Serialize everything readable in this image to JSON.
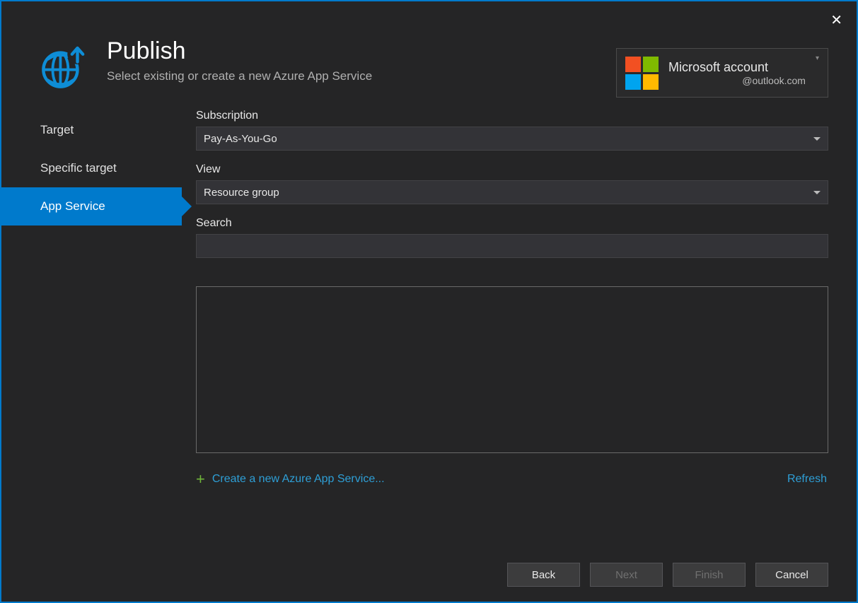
{
  "header": {
    "title": "Publish",
    "subtitle": "Select existing or create a new Azure App Service"
  },
  "account": {
    "label": "Microsoft account",
    "email": "@outlook.com"
  },
  "sidebar": {
    "items": [
      {
        "label": "Target",
        "selected": false
      },
      {
        "label": "Specific target",
        "selected": false
      },
      {
        "label": "App Service",
        "selected": true
      }
    ]
  },
  "form": {
    "subscription_label": "Subscription",
    "subscription_value": "Pay-As-You-Go",
    "view_label": "View",
    "view_value": "Resource group",
    "search_label": "Search",
    "search_value": ""
  },
  "links": {
    "create": "Create a new Azure App Service...",
    "refresh": "Refresh"
  },
  "buttons": {
    "back": "Back",
    "next": "Next",
    "finish": "Finish",
    "cancel": "Cancel"
  }
}
